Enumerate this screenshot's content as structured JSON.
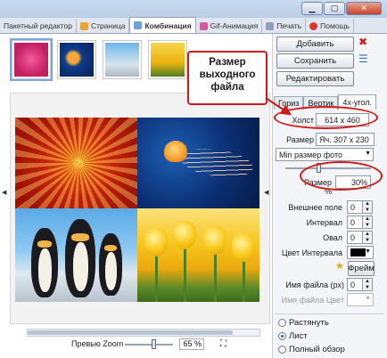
{
  "window": {
    "buttons": [
      "minimize",
      "maximize",
      "close"
    ]
  },
  "tabs": [
    {
      "label": "Пакетный редактор",
      "icon": ""
    },
    {
      "label": "Страница",
      "icon": "page-icon"
    },
    {
      "label": "Комбинация",
      "icon": "combine-icon",
      "active": true
    },
    {
      "label": "Gif-Анимация",
      "icon": "gif-icon"
    },
    {
      "label": "Печать",
      "icon": "print-icon"
    },
    {
      "label": "Помощь",
      "icon": "help-icon"
    }
  ],
  "thumbs": [
    "flower",
    "jellyfish",
    "penguins",
    "tulips"
  ],
  "actions": {
    "add": "Добавить",
    "save": "Сохранить",
    "edit": "Редактировать"
  },
  "layout_tabs": [
    "Гориз",
    "Вертик",
    "4х-угол."
  ],
  "settings": {
    "canvas_label": "Холст",
    "canvas_value": "614 x 460",
    "size_label": "Размер",
    "size_value": "Яч. 307 x 230",
    "min_size_option": "Min размер фото",
    "size_pct_label": "Размер %",
    "size_pct_value": "30%",
    "outer_margin_label": "Внешнее поле",
    "outer_margin_value": "0",
    "interval_label": "Интервал",
    "interval_value": "0",
    "oval_label": "Овал",
    "oval_value": "0",
    "interval_color_label": "Цвет Интервала",
    "interval_color": "#000000",
    "frame_button": "Фрейм",
    "filename_label": "Имя файла (px)",
    "filename_value": "0",
    "filename_color_label": "Имя файла Цвет"
  },
  "fit_options": [
    {
      "label": "Растянуть",
      "selected": false
    },
    {
      "label": "Лист",
      "selected": true
    },
    {
      "label": "Полный обзор",
      "selected": false
    }
  ],
  "preview": {
    "zoom_label": "Превью Zoom",
    "zoom_value": "65 %"
  },
  "callout": {
    "text_line1": "Размер",
    "text_line2": "выходного",
    "text_line3": "файла"
  },
  "colors": {
    "accent_red": "#d11a1a",
    "selection_blue": "#7aa7e3"
  }
}
